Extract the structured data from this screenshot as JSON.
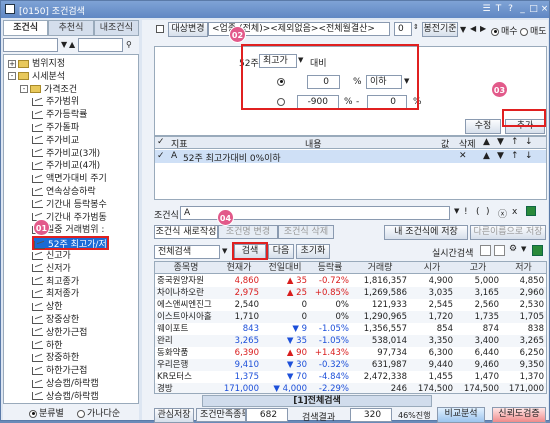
{
  "window": {
    "title": "[0150] 조건검색",
    "controls": [
      "☰",
      "T",
      "?",
      "_",
      "□",
      "×"
    ]
  },
  "left": {
    "tabs": [
      "조건식",
      "추천식",
      "내조건식"
    ],
    "tree": [
      {
        "label": "범위지정",
        "level": 0,
        "type": "folder",
        "pm": "+"
      },
      {
        "label": "시세분석",
        "level": 0,
        "type": "folder",
        "pm": "-"
      },
      {
        "label": "가격조건",
        "level": 1,
        "type": "folder",
        "pm": "-"
      },
      {
        "label": "주가범위",
        "level": 2,
        "type": "item"
      },
      {
        "label": "주가등락률",
        "level": 2,
        "type": "item"
      },
      {
        "label": "주가돌파",
        "level": 2,
        "type": "item"
      },
      {
        "label": "주가비교",
        "level": 2,
        "type": "item"
      },
      {
        "label": "주가비교(3개)",
        "level": 2,
        "type": "item"
      },
      {
        "label": "주가비교(4개)",
        "level": 2,
        "type": "item"
      },
      {
        "label": "액면가대비 주기",
        "level": 2,
        "type": "item"
      },
      {
        "label": "연속상승하락",
        "level": 2,
        "type": "item"
      },
      {
        "label": "기간내 등락봉수",
        "level": 2,
        "type": "item"
      },
      {
        "label": "기간내 주가범동",
        "level": 2,
        "type": "item"
      },
      {
        "label": "일중 거래범위 :",
        "level": 2,
        "type": "item"
      },
      {
        "label": "52주 최고가/저",
        "level": 2,
        "type": "item",
        "selected": true
      },
      {
        "label": "신고가",
        "level": 2,
        "type": "item"
      },
      {
        "label": "신저가",
        "level": 2,
        "type": "item"
      },
      {
        "label": "최고종가",
        "level": 2,
        "type": "item"
      },
      {
        "label": "최저종가",
        "level": 2,
        "type": "item"
      },
      {
        "label": "상한",
        "level": 2,
        "type": "item"
      },
      {
        "label": "장중상한",
        "level": 2,
        "type": "item"
      },
      {
        "label": "상한가근접",
        "level": 2,
        "type": "item"
      },
      {
        "label": "하한",
        "level": 2,
        "type": "item"
      },
      {
        "label": "장중하한",
        "level": 2,
        "type": "item"
      },
      {
        "label": "하한가근접",
        "level": 2,
        "type": "item"
      },
      {
        "label": "상승캡/하락캡",
        "level": 2,
        "type": "item"
      },
      {
        "label": "상승캡/하락캡",
        "level": 2,
        "type": "item"
      }
    ],
    "radio": {
      "opt1": "분류별",
      "opt2": "가나다순"
    }
  },
  "toolbar": {
    "target_btn": "대상변경",
    "target_text": "<업종:(전체)><제외없음><전체월결산>",
    "spin": "0",
    "period_btn": "봉전기준",
    "sell_type": "매수",
    "buy_type": "매도"
  },
  "condition": {
    "label52": "52주",
    "sel": "최고가",
    "vs": "대비",
    "r1_v": "0",
    "r1_unit": "%",
    "r1_sel": "이하",
    "r2_v1": "-900",
    "r2_u": "%",
    "r2_dash": "-",
    "r2_v2": "0",
    "r2_u2": "%"
  },
  "buttons": {
    "edit": "수정",
    "add": "추가"
  },
  "grid1": {
    "headers": [
      "지표",
      "내용",
      "값",
      "삭제",
      "▲",
      "▼",
      "↑",
      "↓"
    ],
    "row": {
      "chk": "✓",
      "id": "A",
      "content": "52주 최고가대비 0%이하"
    }
  },
  "formula": {
    "label": "조건식",
    "value": "A",
    "ops": [
      "!",
      "(",
      ")",
      "ⓧ",
      "x"
    ]
  },
  "formula_btns": {
    "new": "조건식 새로작성",
    "rename": "조건명 변경",
    "del": "조건식 삭제",
    "save": "내 조건식에 저장",
    "saveas": "다른이름으로 저장"
  },
  "search": {
    "select": "전체검색",
    "btn_search": "검색",
    "btn_next": "다음",
    "btn_reset": "초기화",
    "realtime": "실시간검색"
  },
  "table": {
    "headers": [
      "종목명",
      "현재가",
      "전일대비",
      "등락률",
      "거래량",
      "시가",
      "고가",
      "저가"
    ],
    "rows": [
      {
        "name": "중국원양자원",
        "price": "4,860",
        "sign": "up",
        "diff": "35",
        "rate": "-0.72%",
        "vol": "1,816,357",
        "open": "4,900",
        "high": "5,000",
        "low": "4,850"
      },
      {
        "name": "차이나하오란",
        "price": "2,975",
        "sign": "up",
        "diff": "25",
        "rate": "+0.85%",
        "vol": "1,269,586",
        "open": "3,035",
        "high": "3,165",
        "low": "2,960"
      },
      {
        "name": "에스앤씨엔진그",
        "price": "2,540",
        "sign": "",
        "diff": "0",
        "rate": "0%",
        "vol": "121,933",
        "open": "2,545",
        "high": "2,560",
        "low": "2,530"
      },
      {
        "name": "이스트아시아홀",
        "price": "1,710",
        "sign": "",
        "diff": "0",
        "rate": "0%",
        "vol": "1,290,965",
        "open": "1,720",
        "high": "1,735",
        "low": "1,705"
      },
      {
        "name": "웨이포트",
        "price": "843",
        "sign": "dn",
        "diff": "9",
        "rate": "-1.05%",
        "vol": "1,356,557",
        "open": "854",
        "high": "874",
        "low": "838"
      },
      {
        "name": "완리",
        "price": "3,265",
        "sign": "dn",
        "diff": "35",
        "rate": "-1.05%",
        "vol": "538,014",
        "open": "3,350",
        "high": "3,400",
        "low": "3,265"
      },
      {
        "name": "동화약품",
        "price": "6,390",
        "sign": "up",
        "diff": "90",
        "rate": "+1.43%",
        "vol": "97,734",
        "open": "6,300",
        "high": "6,440",
        "low": "6,250"
      },
      {
        "name": "우리은행",
        "price": "9,410",
        "sign": "dn",
        "diff": "30",
        "rate": "-0.32%",
        "vol": "631,987",
        "open": "9,440",
        "high": "9,460",
        "low": "9,350"
      },
      {
        "name": "KR모터스",
        "price": "1,375",
        "sign": "dn",
        "diff": "70",
        "rate": "-4.84%",
        "vol": "2,472,338",
        "open": "1,455",
        "high": "1,470",
        "low": "1,370"
      },
      {
        "name": "경방",
        "price": "171,000",
        "sign": "dn",
        "diff": "4,000",
        "rate": "-2.29%",
        "vol": "246",
        "open": "174,500",
        "high": "174,500",
        "low": "171,000"
      }
    ]
  },
  "bottom_tab": "[1]전체검색",
  "status": {
    "save": "관심저장",
    "count_label": "조건만족종목",
    "count": "682",
    "result_label": "검색결과",
    "result": "320",
    "progress": "46%진행",
    "analysis": "비교분석",
    "trust": "신뢰도검증"
  },
  "badges": [
    "01",
    "02",
    "03",
    "04"
  ]
}
